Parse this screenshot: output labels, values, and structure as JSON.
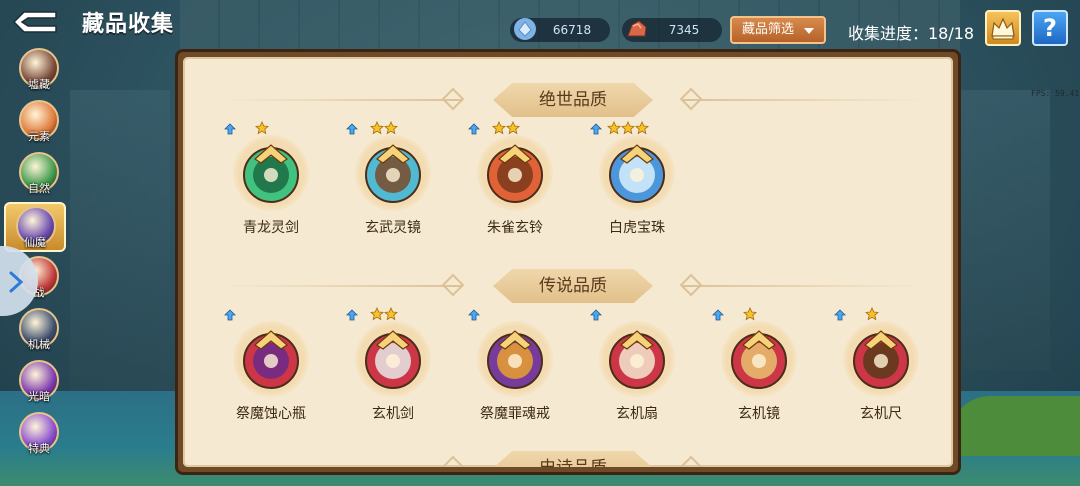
{
  "header": {
    "title": "藏品收集",
    "currency_crystal": "66718",
    "currency_ore": "7345",
    "filter_label": "藏品筛选",
    "progress_text": "收集进度：18/18",
    "help_label": "?"
  },
  "fps": "FPS: 59.41",
  "sidebar": {
    "items": [
      {
        "label": "墟藏",
        "color": "#7b4a3a"
      },
      {
        "label": "元素",
        "color": "#e07a3a"
      },
      {
        "label": "自然",
        "color": "#3f9a4c"
      },
      {
        "label": "仙魔",
        "color": "#6b4bb0"
      },
      {
        "label": "战",
        "color": "#c23a3a"
      },
      {
        "label": "机械",
        "color": "#3d4f6e"
      },
      {
        "label": "光暗",
        "color": "#7d3bb0"
      },
      {
        "label": "特典",
        "color": "#8a4fd0"
      }
    ],
    "active_index": 3
  },
  "sections": [
    {
      "title": "绝世品质",
      "items": [
        {
          "name": "青龙灵剑",
          "stars": 1,
          "color": "#2fbf7a",
          "accent": "#1b6b43"
        },
        {
          "name": "玄武灵镜",
          "stars": 2,
          "color": "#3fb7d6",
          "accent": "#7a4a2a"
        },
        {
          "name": "朱雀玄铃",
          "stars": 2,
          "color": "#e0552a",
          "accent": "#7a3a1a"
        },
        {
          "name": "白虎宝珠",
          "stars": 3,
          "color": "#3a8fe0",
          "accent": "#d8eefc"
        }
      ]
    },
    {
      "title": "传说品质",
      "items": [
        {
          "name": "祭魔蚀心瓶",
          "stars": 0,
          "color": "#c8243a",
          "accent": "#6a2a8a"
        },
        {
          "name": "玄机剑",
          "stars": 2,
          "color": "#c8243a",
          "accent": "#e8e8e8"
        },
        {
          "name": "祭魔罪魂戒",
          "stars": 0,
          "color": "#6a2a9a",
          "accent": "#e8a030"
        },
        {
          "name": "玄机扇",
          "stars": 0,
          "color": "#c8243a",
          "accent": "#f2e6d0"
        },
        {
          "name": "玄机镜",
          "stars": 1,
          "color": "#c8243a",
          "accent": "#e8c070"
        },
        {
          "name": "玄机尺",
          "stars": 1,
          "color": "#c8243a",
          "accent": "#5a3a1a"
        }
      ]
    },
    {
      "title": "史诗品质",
      "items": []
    }
  ]
}
